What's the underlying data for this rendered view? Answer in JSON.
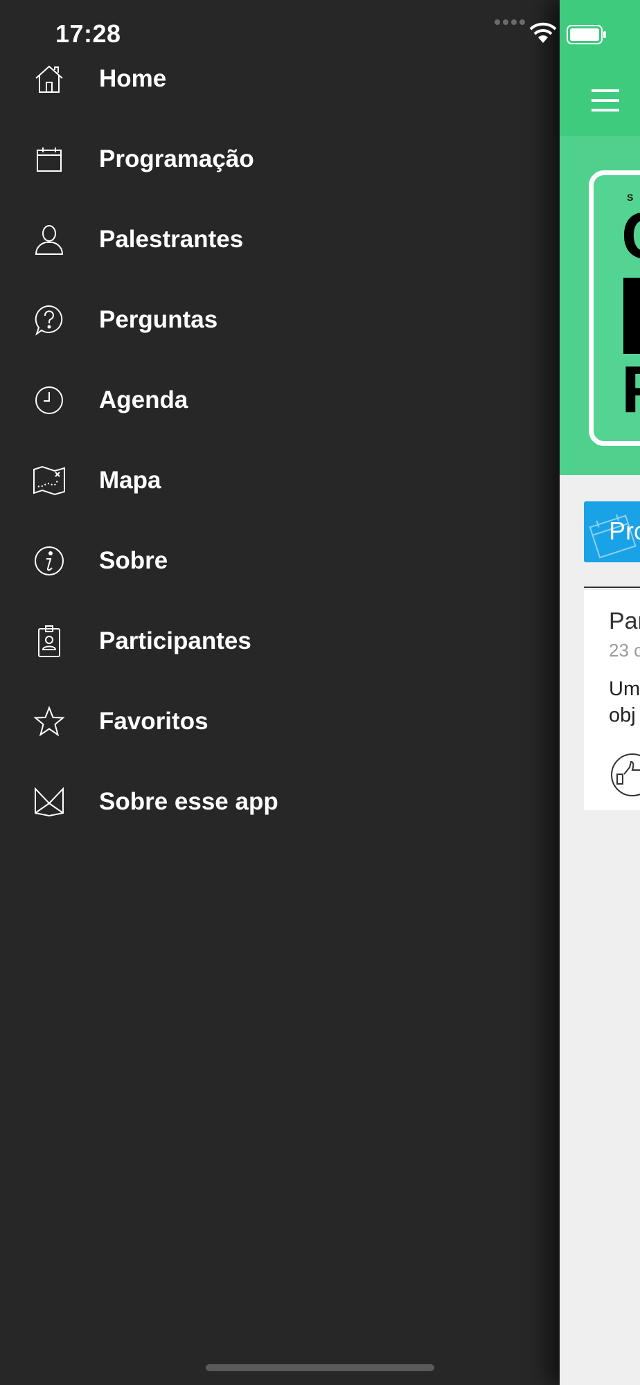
{
  "status_bar": {
    "time": "17:28"
  },
  "menu": {
    "items": [
      {
        "label": "Home",
        "icon": "home-icon"
      },
      {
        "label": "Programação",
        "icon": "calendar-icon"
      },
      {
        "label": "Palestrantes",
        "icon": "person-icon"
      },
      {
        "label": "Perguntas",
        "icon": "question-bubble-icon"
      },
      {
        "label": "Agenda",
        "icon": "clock-icon"
      },
      {
        "label": "Mapa",
        "icon": "map-icon"
      },
      {
        "label": "Sobre",
        "icon": "info-icon"
      },
      {
        "label": "Participantes",
        "icon": "badge-icon"
      },
      {
        "label": "Favoritos",
        "icon": "star-icon"
      },
      {
        "label": "Sobre esse app",
        "icon": "envelope-icon"
      }
    ]
  },
  "main_panel": {
    "banner": {
      "small_text": "S",
      "big_letter_top": "C",
      "big_letter_bottom": "F"
    },
    "program_button_label": "Pro",
    "card": {
      "title": "Par",
      "date": "23 c",
      "body_line1": "Um",
      "body_line2": "obj"
    }
  },
  "colors": {
    "drawer_bg": "#272727",
    "header_green": "#3ecb7d",
    "banner_green": "#4fd08d",
    "program_blue": "#1aa2e6"
  }
}
